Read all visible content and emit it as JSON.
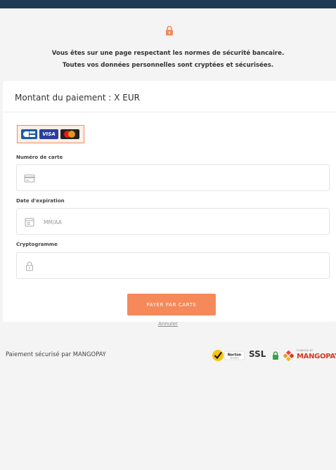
{
  "header": {
    "security_line1": "Vous êtes sur une page respectant les normes de sécurité bancaire.",
    "security_line2": "Toutes vos données personnelles sont cryptées et sécurisées."
  },
  "payment": {
    "amount_title": "Montant du paiement : X EUR",
    "card_brands": [
      "CB",
      "VISA",
      "Mastercard"
    ],
    "visa_label": "VISA",
    "card_number": {
      "label": "Numéro de carte",
      "value": "",
      "placeholder": ""
    },
    "expiry": {
      "label": "Date d'expiration",
      "value": "",
      "placeholder": "MM/AA"
    },
    "cvv": {
      "label": "Cryptogramme",
      "value": "",
      "placeholder": ""
    },
    "pay_button_label": "PAYER PAR CARTE",
    "cancel_label": "Annuler"
  },
  "footer": {
    "secure_text": "Paiement sécurisé par MANGOPAY",
    "norton_label": "Norton",
    "norton_sub": "SECURED",
    "ssl_label": "SSL",
    "powered_by": "POWERED BY",
    "mangopay_label": "MANGOPAY"
  },
  "colors": {
    "top_bar": "#1e3a52",
    "accent": "#f5895a",
    "mangopay_red": "#d9381e"
  },
  "icons": [
    "lock-icon",
    "card-icon",
    "calendar-icon",
    "padlock-icon",
    "norton-check-icon",
    "ssl-lock-icon",
    "mangopay-logo-icon"
  ]
}
